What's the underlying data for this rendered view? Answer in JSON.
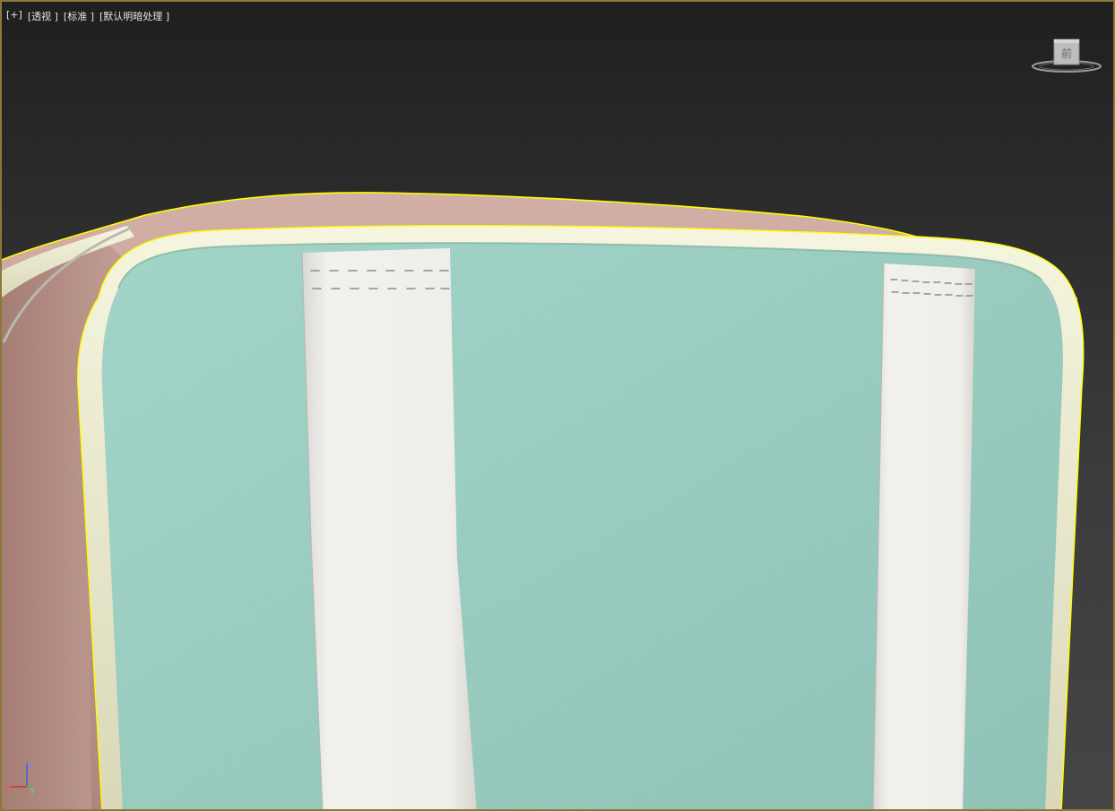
{
  "viewport": {
    "labels": [
      "[+]",
      "[透视 ]",
      "[标准 ]",
      "[默认明暗处理 ]"
    ]
  },
  "viewcube": {
    "face_label": "前"
  },
  "axis_gizmo": {
    "x_label": "x",
    "y_label": "y",
    "z_label": "z"
  },
  "colors": {
    "selection_outline": "#ffff00",
    "viewport_border": "#8a7a3a",
    "pink_leather": "#c9a49c",
    "mint_leather": "#9dd0c4",
    "cream_piping": "#ecebcc",
    "white_strap": "#f0efeb",
    "axis_x": "#d03030",
    "axis_y": "#40c040",
    "axis_z": "#4060e0"
  },
  "icons": {
    "viewcube": "viewcube-icon",
    "axis": "axis-tripod-icon"
  }
}
